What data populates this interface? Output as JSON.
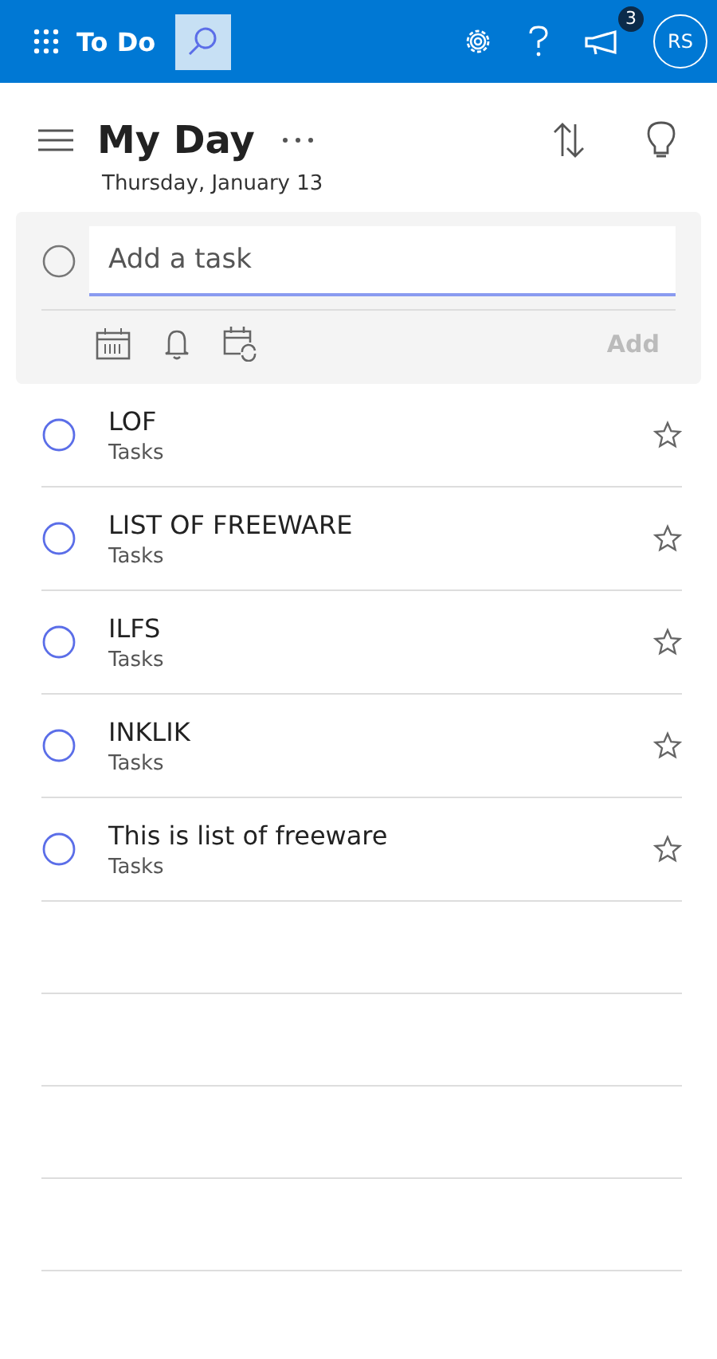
{
  "app_bar": {
    "title": "To Do",
    "search_active": true,
    "notification_count": "3",
    "avatar": "RS"
  },
  "list": {
    "title": "My Day",
    "date": "Thursday, January 13"
  },
  "add_task": {
    "placeholder": "Add a task",
    "button": "Add",
    "button_disabled": true
  },
  "tasks": [
    {
      "title": "LOF",
      "list": "Tasks",
      "completed": false,
      "important": false
    },
    {
      "title": "LIST OF FREEWARE",
      "list": "Tasks",
      "completed": false,
      "important": false
    },
    {
      "title": "ILFS",
      "list": "Tasks",
      "completed": false,
      "important": false
    },
    {
      "title": "INKLIK",
      "list": "Tasks",
      "completed": false,
      "important": false
    },
    {
      "title": "This is list of freeware",
      "list": "Tasks",
      "completed": false,
      "important": false
    }
  ]
}
